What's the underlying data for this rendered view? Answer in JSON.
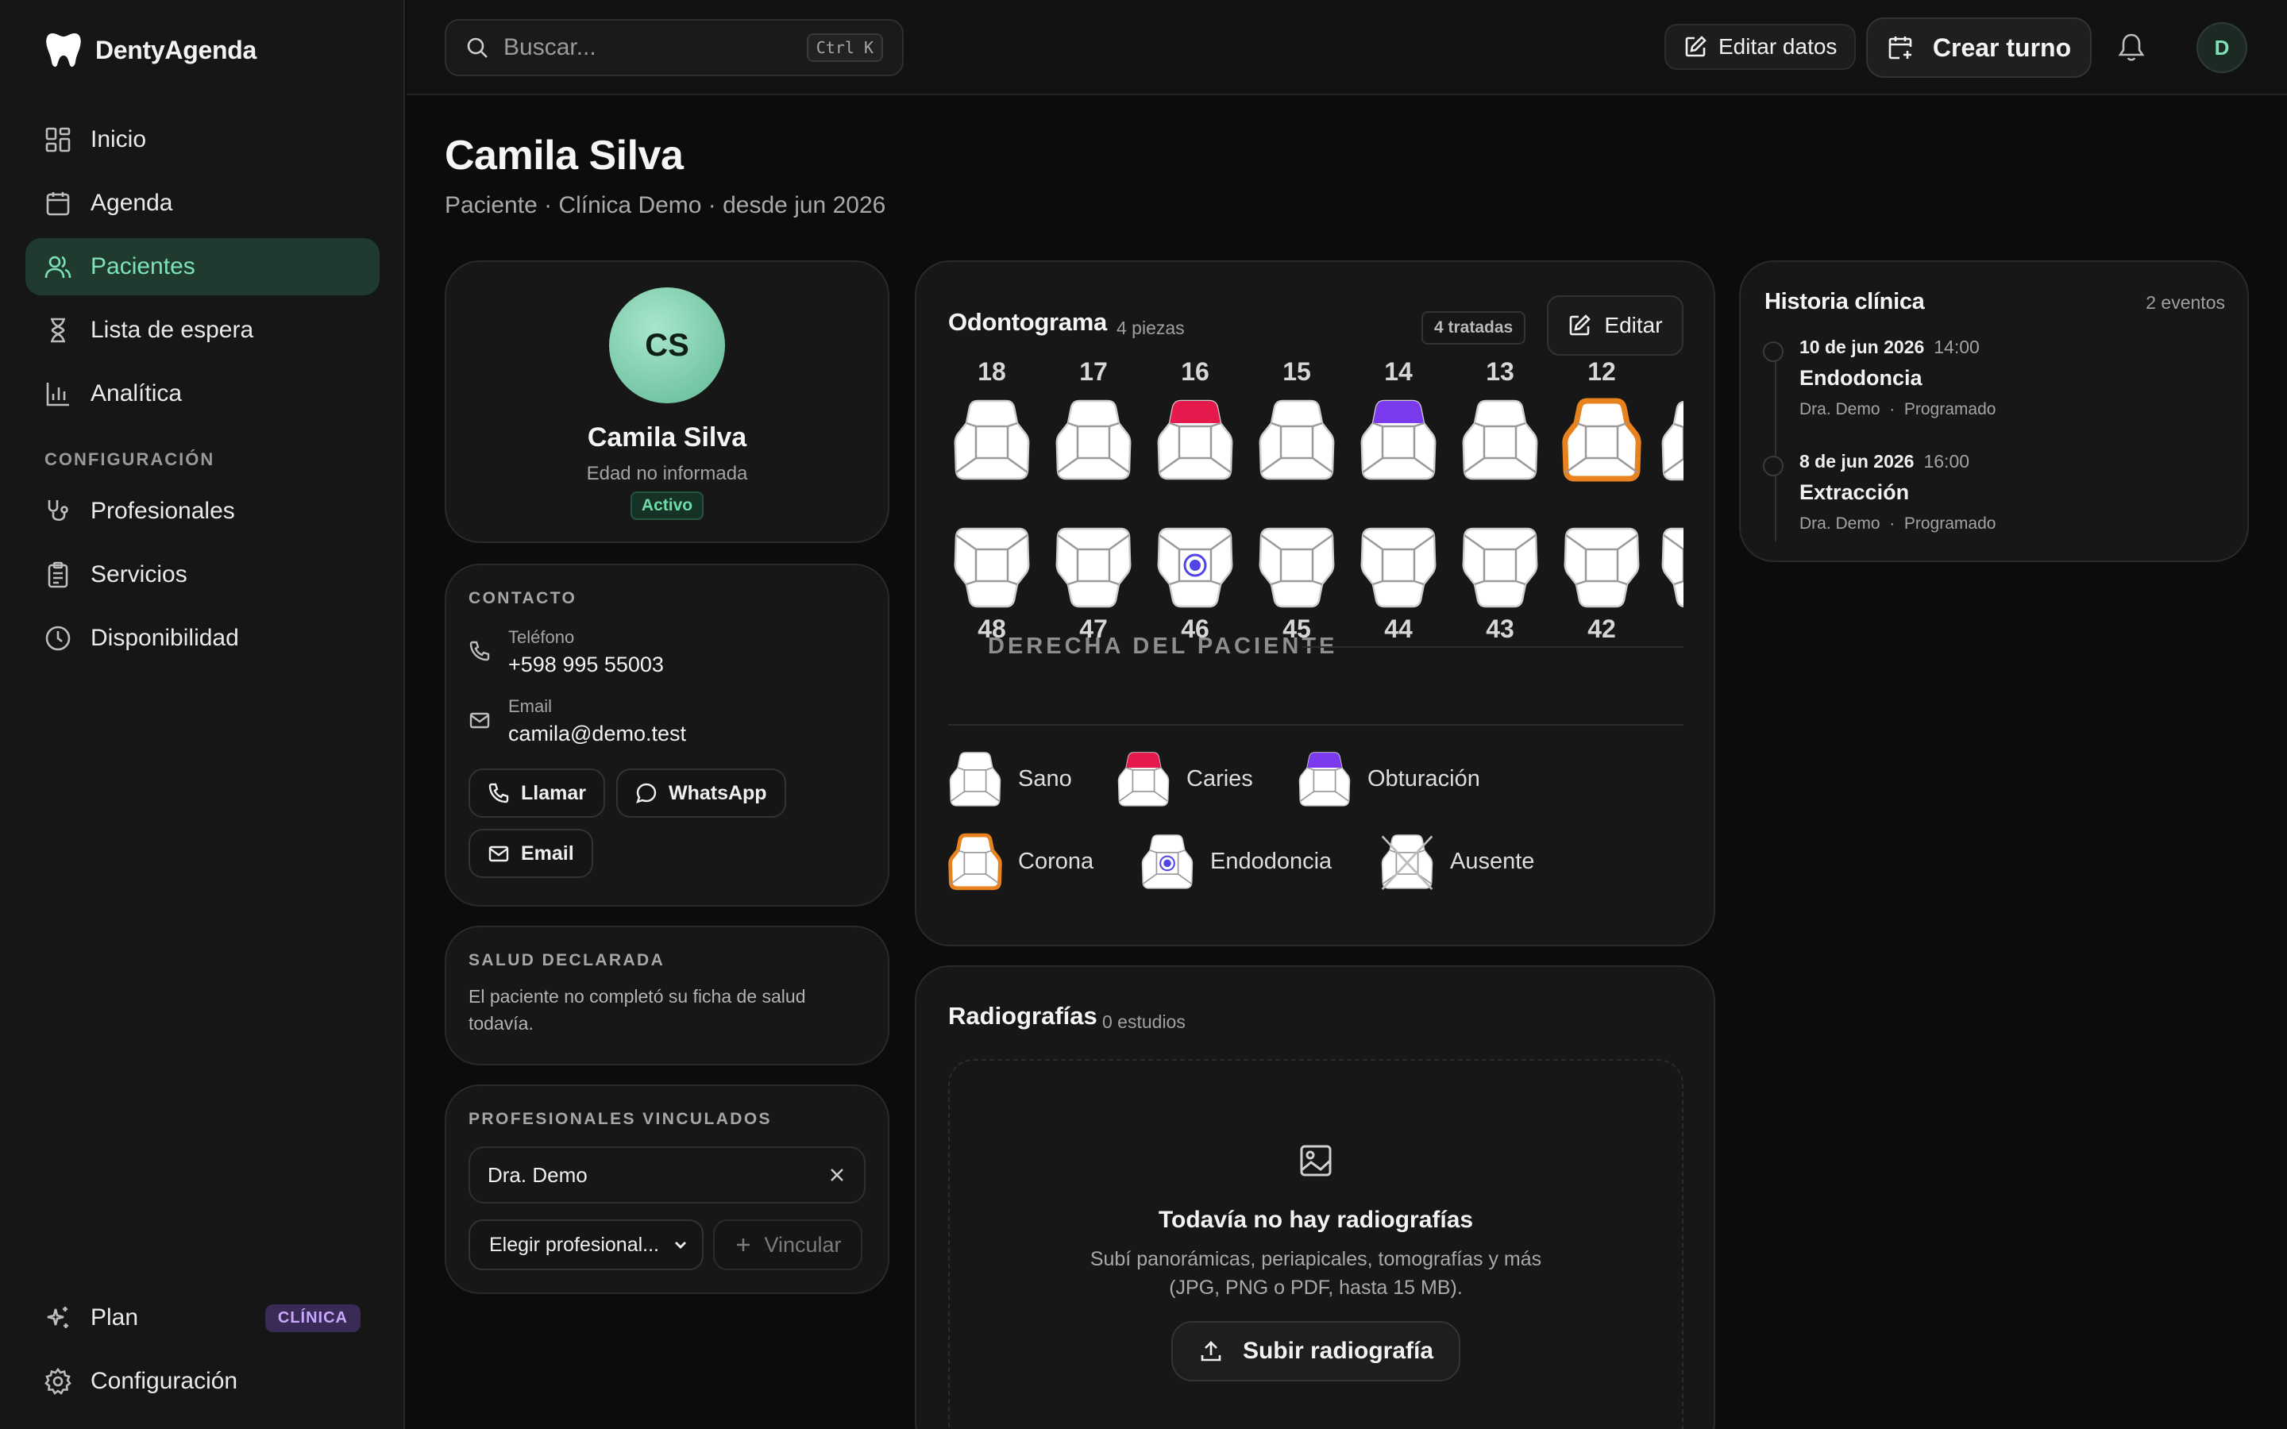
{
  "app": {
    "name": "DentyAgenda"
  },
  "sidebar": {
    "items": [
      {
        "label": "Inicio",
        "icon": "dashboard-icon"
      },
      {
        "label": "Agenda",
        "icon": "calendar-icon"
      },
      {
        "label": "Pacientes",
        "icon": "users-icon",
        "active": true
      },
      {
        "label": "Lista de espera",
        "icon": "hourglass-icon"
      },
      {
        "label": "Analítica",
        "icon": "chart-icon"
      }
    ],
    "section_config": "CONFIGURACIÓN",
    "config_items": [
      {
        "label": "Profesionales",
        "icon": "stethoscope-icon"
      },
      {
        "label": "Servicios",
        "icon": "clipboard-icon"
      },
      {
        "label": "Disponibilidad",
        "icon": "clock-icon"
      }
    ],
    "plan": {
      "label": "Plan",
      "badge": "CLÍNICA",
      "icon": "sparkles-icon"
    },
    "settings": {
      "label": "Configuración",
      "icon": "gear-icon"
    }
  },
  "topbar": {
    "search_placeholder": "Buscar...",
    "shortcut": "Ctrl K",
    "edit_label": "Editar datos",
    "create_label": "Crear turno",
    "user_initial": "D"
  },
  "page": {
    "title": "Camila Silva",
    "subtitle": "Paciente · Clínica Demo · desde jun 2026"
  },
  "profile": {
    "initials": "CS",
    "name": "Camila Silva",
    "age": "Edad no informada",
    "status": "Activo"
  },
  "contact": {
    "heading": "CONTACTO",
    "phone_label": "Teléfono",
    "phone": "+598 995 55003",
    "email_label": "Email",
    "email": "camila@demo.test",
    "actions": {
      "call": "Llamar",
      "whatsapp": "WhatsApp",
      "email": "Email"
    }
  },
  "health": {
    "heading": "SALUD DECLARADA",
    "text": "El paciente no completó su ficha de salud todavía."
  },
  "professionals": {
    "heading": "PROFESIONALES VINCULADOS",
    "linked": [
      "Dra. Demo"
    ],
    "select_placeholder": "Elegir profesional...",
    "link_label": "Vincular"
  },
  "odontogram": {
    "title": "Odontograma",
    "count": "4 piezas",
    "treated": "4 tratadas",
    "edit_label": "Editar",
    "divider": "DERECHA DEL PACIENTE",
    "upper": [
      {
        "num": "18",
        "state": "sano"
      },
      {
        "num": "17",
        "state": "sano"
      },
      {
        "num": "16",
        "state": "caries"
      },
      {
        "num": "15",
        "state": "sano"
      },
      {
        "num": "14",
        "state": "obturacion"
      },
      {
        "num": "13",
        "state": "sano"
      },
      {
        "num": "12",
        "state": "corona"
      }
    ],
    "lower": [
      {
        "num": "48",
        "state": "sano"
      },
      {
        "num": "47",
        "state": "sano"
      },
      {
        "num": "46",
        "state": "endodoncia"
      },
      {
        "num": "45",
        "state": "sano"
      },
      {
        "num": "44",
        "state": "sano"
      },
      {
        "num": "43",
        "state": "sano"
      },
      {
        "num": "42",
        "state": "sano"
      }
    ],
    "legend": [
      {
        "label": "Sano",
        "state": "sano"
      },
      {
        "label": "Caries",
        "state": "caries"
      },
      {
        "label": "Obturación",
        "state": "obturacion"
      },
      {
        "label": "Corona",
        "state": "corona"
      },
      {
        "label": "Endodoncia",
        "state": "endodoncia"
      },
      {
        "label": "Ausente",
        "state": "ausente"
      }
    ],
    "colors": {
      "caries": "#e5194b",
      "obturacion": "#7c3aed",
      "corona": "#e8821e",
      "endodoncia": "#4f46e5"
    }
  },
  "radiographs": {
    "title": "Radiografías",
    "count": "0 estudios",
    "empty_title": "Todavía no hay radiografías",
    "empty_line1": "Subí panorámicas, periapicales, tomografías y más",
    "empty_line2": "(JPG, PNG o PDF, hasta 15 MB).",
    "upload_label": "Subir radiografía"
  },
  "history": {
    "title": "Historia clínica",
    "count": "2 eventos",
    "events": [
      {
        "date": "10 de jun 2026",
        "time": "14:00",
        "title": "Endodoncia",
        "doctor": "Dra. Demo",
        "status": "Programado"
      },
      {
        "date": "8 de jun 2026",
        "time": "16:00",
        "title": "Extracción",
        "doctor": "Dra. Demo",
        "status": "Programado"
      }
    ]
  }
}
